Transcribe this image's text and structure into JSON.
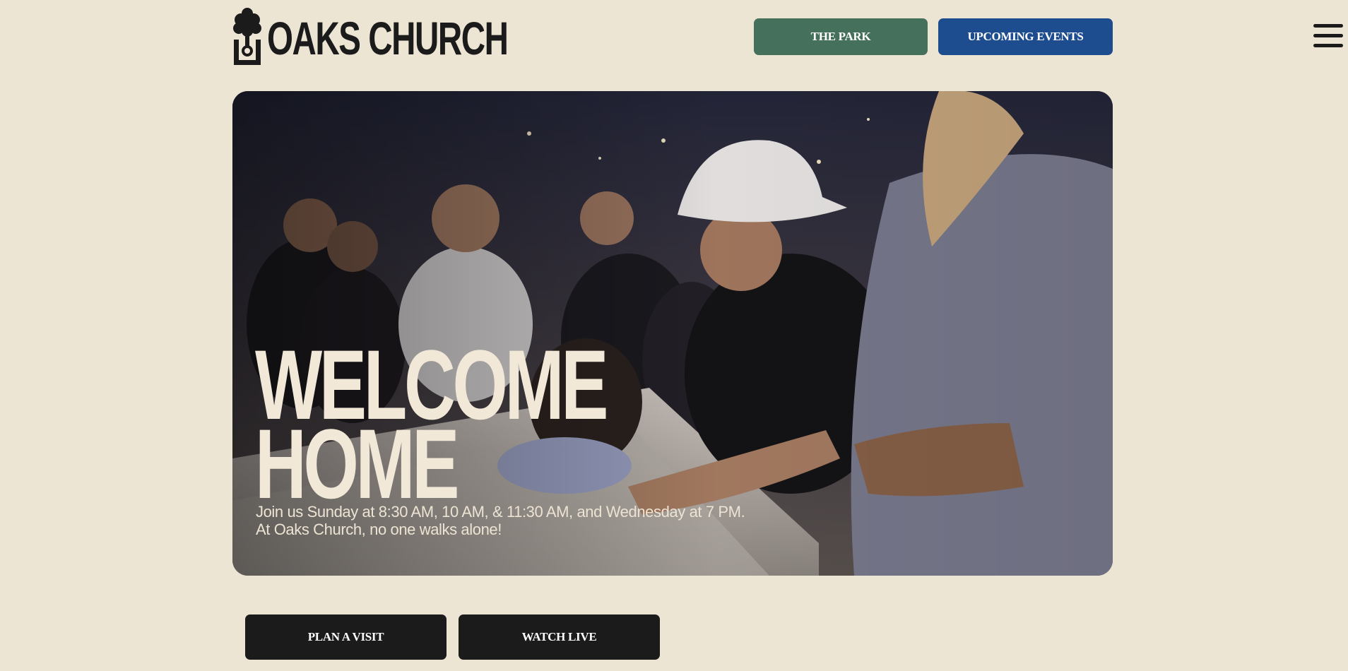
{
  "header": {
    "logo_text": "OAKS CHURCH",
    "buttons": {
      "park": "THE PARK",
      "events": "UPCOMING EVENTS"
    }
  },
  "hero": {
    "title_line1": "WELCOME",
    "title_line2": "HOME",
    "subtitle_line1": "Join us Sunday at 8:30 AM, 10 AM, & 11:30 AM, and Wednesday at 7 PM.",
    "subtitle_line2": "At Oaks Church, no one walks alone!"
  },
  "cta": {
    "plan_visit": "PLAN A VISIT",
    "watch_live": "WATCH LIVE"
  },
  "icons": {
    "logo": "tree-icon",
    "menu": "hamburger-menu-icon"
  },
  "colors": {
    "background": "#ede5d4",
    "park_button": "#45715c",
    "events_button": "#1d4d8f",
    "cta_button": "#1b1b1b",
    "hero_text": "#f1e8d8"
  }
}
